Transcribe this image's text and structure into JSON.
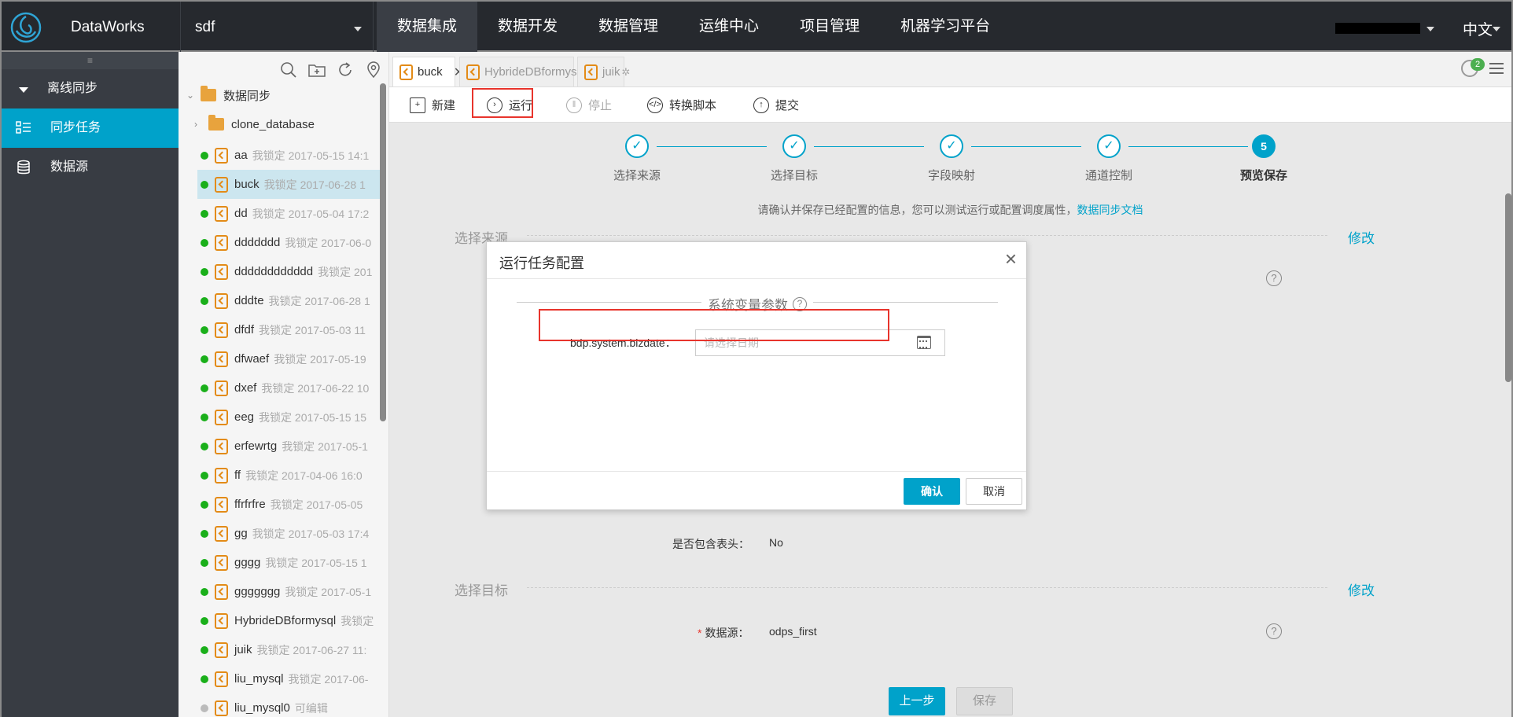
{
  "brand": {
    "name": "DataWorks"
  },
  "project": {
    "name": "sdf"
  },
  "nav": {
    "items": [
      "数据集成",
      "数据开发",
      "数据管理",
      "运维中心",
      "项目管理",
      "机器学习平台"
    ],
    "active_index": 0
  },
  "lang": "中文",
  "sidebar": {
    "group": "离线同步",
    "items": [
      {
        "label": "同步任务",
        "icon": "task-list-icon",
        "active": true
      },
      {
        "label": "数据源",
        "icon": "database-icon",
        "active": false
      }
    ]
  },
  "tree": {
    "root": "数据同步",
    "child_folder": "clone_database",
    "items": [
      {
        "name": "aa",
        "meta": "我锁定 2017-05-15 14:1",
        "status": "online"
      },
      {
        "name": "buck",
        "meta": "我锁定 2017-06-28 1",
        "status": "online",
        "selected": true
      },
      {
        "name": "dd",
        "meta": "我锁定 2017-05-04 17:2",
        "status": "online"
      },
      {
        "name": "ddddddd",
        "meta": "我锁定 2017-06-0",
        "status": "online"
      },
      {
        "name": "dddddddddddd",
        "meta": "我锁定 201",
        "status": "online"
      },
      {
        "name": "dddte",
        "meta": "我锁定 2017-06-28 1",
        "status": "online"
      },
      {
        "name": "dfdf",
        "meta": "我锁定 2017-05-03 11",
        "status": "online"
      },
      {
        "name": "dfwaef",
        "meta": "我锁定 2017-05-19",
        "status": "online"
      },
      {
        "name": "dxef",
        "meta": "我锁定 2017-06-22 10",
        "status": "online"
      },
      {
        "name": "eeg",
        "meta": "我锁定 2017-05-15 15",
        "status": "online"
      },
      {
        "name": "erfewrtg",
        "meta": "我锁定 2017-05-1",
        "status": "online"
      },
      {
        "name": "ff",
        "meta": "我锁定 2017-04-06 16:0",
        "status": "online"
      },
      {
        "name": "ffrfrfre",
        "meta": "我锁定 2017-05-05",
        "status": "online"
      },
      {
        "name": "gg",
        "meta": "我锁定 2017-05-03 17:4",
        "status": "online"
      },
      {
        "name": "gggg",
        "meta": "我锁定 2017-05-15 1",
        "status": "online"
      },
      {
        "name": "ggggggg",
        "meta": "我锁定 2017-05-1",
        "status": "online"
      },
      {
        "name": "HybrideDBformysql",
        "meta": "我锁定",
        "status": "online"
      },
      {
        "name": "juik",
        "meta": "我锁定 2017-06-27 11:",
        "status": "online"
      },
      {
        "name": "liu_mysql",
        "meta": "我锁定 2017-06-",
        "status": "online"
      },
      {
        "name": "liu_mysql0",
        "meta": "可编辑",
        "status": "offline"
      }
    ]
  },
  "tabs": [
    {
      "label": "buck",
      "active": true
    },
    {
      "label": "HybrideDBformysql",
      "active": false
    },
    {
      "label": "juik",
      "active": false
    }
  ],
  "notifications": {
    "count": "2"
  },
  "toolbar": {
    "new": "新建",
    "run": "运行",
    "stop": "停止",
    "convert": "转换脚本",
    "submit": "提交"
  },
  "steps": [
    {
      "label": "选择来源"
    },
    {
      "label": "选择目标"
    },
    {
      "label": "字段映射"
    },
    {
      "label": "通道控制"
    },
    {
      "label": "预览保存",
      "number": "5",
      "current": true
    }
  ],
  "hint": {
    "text": "请确认并保存已经配置的信息，您可以测试运行或配置调度属性，",
    "link": "数据同步文档"
  },
  "source_section": {
    "title": "选择来源",
    "edit": "修改",
    "header_label": "是否包含表头：",
    "header_value": "No"
  },
  "target_section": {
    "title": "选择目标",
    "edit": "修改",
    "ds_label": "数据源：",
    "ds_value": "odps_first"
  },
  "footer": {
    "prev": "上一步",
    "save": "保存"
  },
  "modal": {
    "title": "运行任务配置",
    "legend": "系统变量参数",
    "field_label": "bdp.system.bizdate：",
    "date_placeholder": "请选择日期",
    "ok": "确认",
    "cancel": "取消"
  },
  "colors": {
    "accent": "#00a2ca",
    "topbar": "#26292e",
    "sidebar": "#383c43",
    "highlight_box": "#e8342c",
    "online": "#1aaf1a"
  }
}
